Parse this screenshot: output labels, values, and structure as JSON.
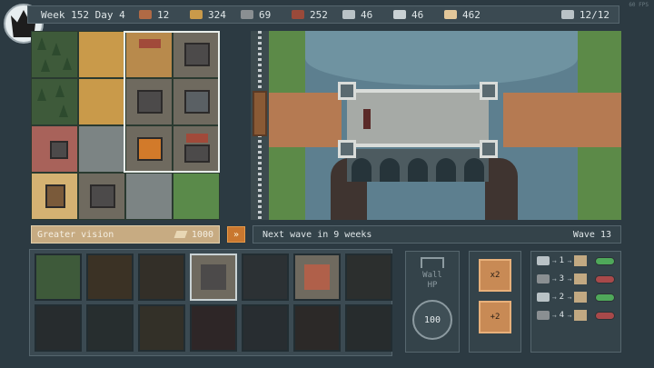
{
  "topbar": {
    "week_day": "Week 152 Day 4",
    "resources": [
      {
        "icon": "wood-log-icon",
        "value": "12",
        "color": "#b06a45"
      },
      {
        "icon": "wheat-icon",
        "value": "324",
        "color": "#c99a4a"
      },
      {
        "icon": "bread-icon",
        "value": "69",
        "color": "#8a8f92"
      },
      {
        "icon": "brick-icon",
        "value": "252",
        "color": "#9a4a3a"
      },
      {
        "icon": "pickaxe-icon",
        "value": "46",
        "color": "#b9c2c6"
      },
      {
        "icon": "iron-bar-icon",
        "value": "46",
        "color": "#c9d1d4"
      },
      {
        "icon": "gold-bar-icon",
        "value": "462",
        "color": "#e2c79a"
      },
      {
        "icon": "worker-hand-icon",
        "value": "12/12",
        "color": "#b9c2c6"
      }
    ]
  },
  "ability": {
    "label": "Greater vision",
    "cost": "1000"
  },
  "fast_forward": {
    "label": "»"
  },
  "wave": {
    "next_wave": "Next wave in 9 weeks",
    "wave_number": "Wave 13"
  },
  "wall_hp": {
    "label_line1": "Wall",
    "label_line2": "HP",
    "value": "100"
  },
  "powers": [
    {
      "label": "x2"
    },
    {
      "label": "+2"
    }
  ],
  "production": [
    {
      "src": "pickaxe-icon",
      "count": "1",
      "enabled": true
    },
    {
      "src": "bread-icon",
      "count": "3",
      "enabled": false
    },
    {
      "src": "pickaxe-icon",
      "count": "2",
      "enabled": true
    },
    {
      "src": "bread-icon",
      "count": "4",
      "enabled": false
    }
  ],
  "fps": "60 FPS"
}
